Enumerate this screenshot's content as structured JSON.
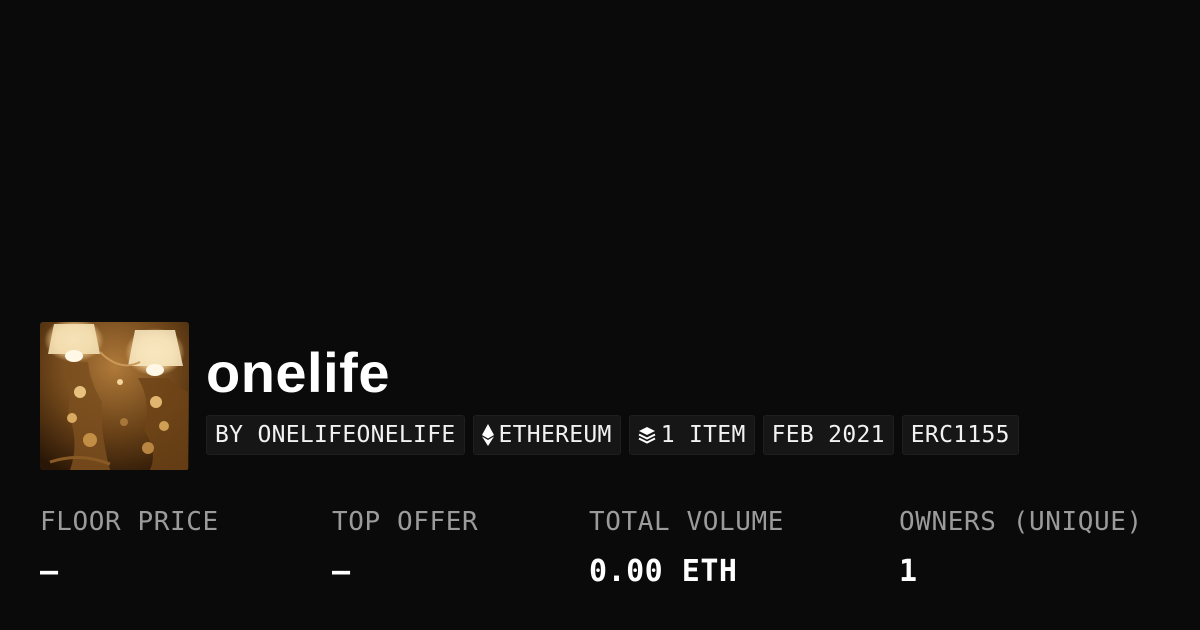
{
  "collection": {
    "name": "onelife",
    "tags": [
      {
        "label": "BY ONELIFEONELIFE",
        "icon": ""
      },
      {
        "label": "ETHEREUM",
        "icon": "ethereum-icon"
      },
      {
        "label": "1 ITEM",
        "icon": "layers-icon"
      },
      {
        "label": "FEB 2021",
        "icon": ""
      },
      {
        "label": "ERC1155",
        "icon": ""
      }
    ]
  },
  "stats": [
    {
      "label": "FLOOR PRICE",
      "value": "—"
    },
    {
      "label": "TOP OFFER",
      "value": "—"
    },
    {
      "label": "TOTAL VOLUME",
      "value": "0.00 ETH"
    },
    {
      "label": "OWNERS (UNIQUE)",
      "value": "1"
    }
  ],
  "colors": {
    "background": "#0a0a0a",
    "chip_background": "#161616",
    "label_gray": "#9b9b9b",
    "text": "#ffffff"
  }
}
